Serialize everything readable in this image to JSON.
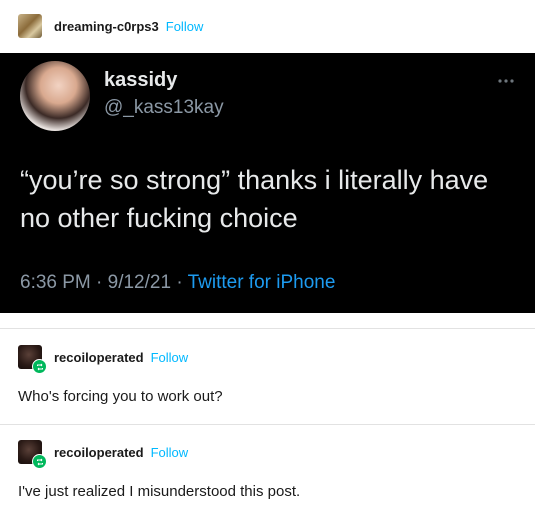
{
  "op": {
    "username": "dreaming-c0rps3",
    "follow_label": "Follow"
  },
  "tweet": {
    "name": "kassidy",
    "handle": "@_kass13kay",
    "more_icon": "more-horizontal-icon",
    "text": "“you’re so strong” thanks i literally have no other fucking choice",
    "time": "6:36 PM · 9/12/21 · ",
    "source": "Twitter for iPhone"
  },
  "replies": [
    {
      "username": "recoiloperated",
      "follow_label": "Follow",
      "body": "Who's forcing you to work out?"
    },
    {
      "username": "recoiloperated",
      "follow_label": "Follow",
      "body": "I've just realized I misunderstood this post."
    }
  ],
  "colors": {
    "follow": "#00b8ff",
    "reblog_badge": "#00b85c",
    "tweet_bg": "#000000",
    "twitter_link": "#1d9bf0"
  }
}
